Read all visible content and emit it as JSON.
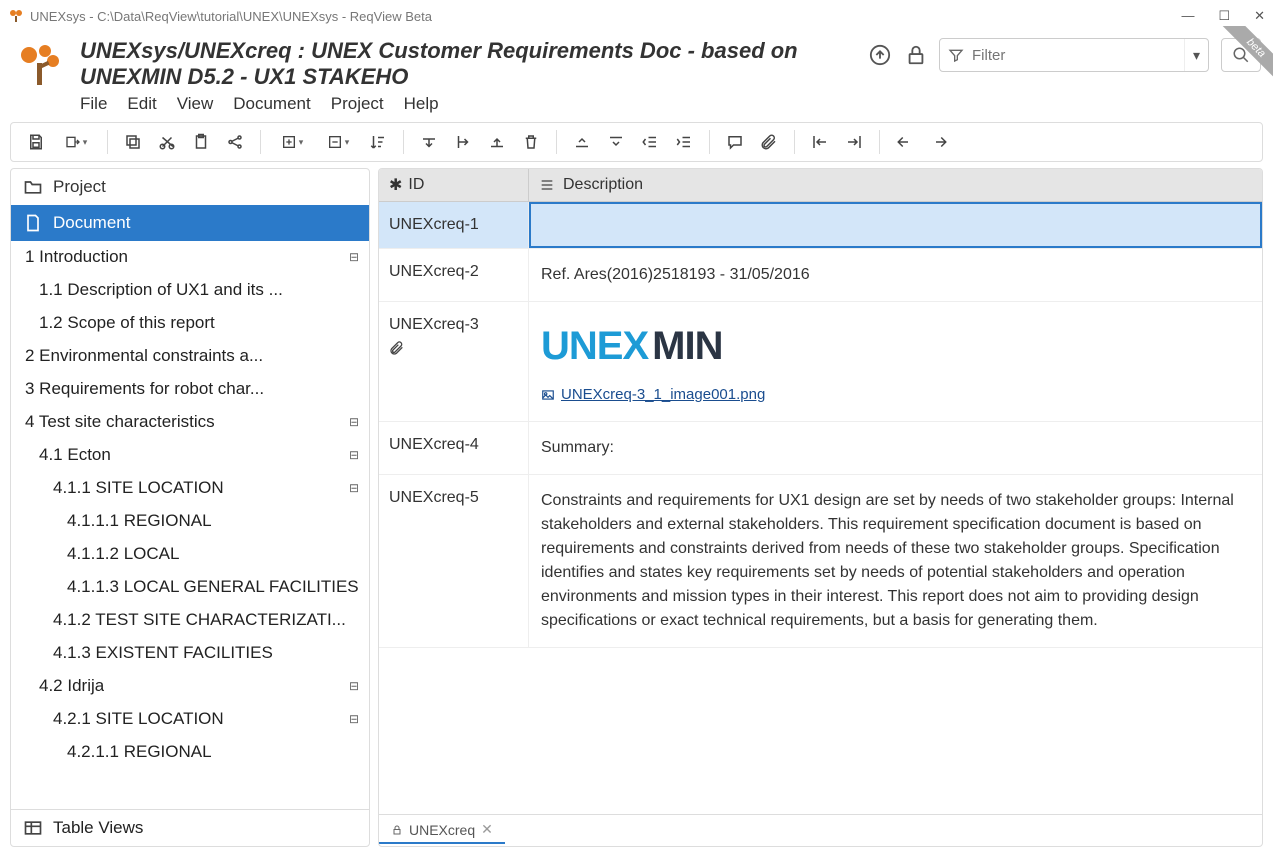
{
  "titlebar": {
    "text": "UNEXsys - C:\\Data\\ReqView\\tutorial\\UNEX\\UNEXsys - ReqView Beta"
  },
  "header": {
    "doc_title": "UNEXsys/UNEXcreq : UNEX Customer Requirements Doc - based on UNEXMIN D5.2 - UX1 STAKEHO",
    "menu": {
      "file": "File",
      "edit": "Edit",
      "view": "View",
      "document": "Document",
      "project": "Project",
      "help": "Help"
    },
    "filter_placeholder": "Filter",
    "beta_label": "beta"
  },
  "sidebar": {
    "project_label": "Project",
    "document_label": "Document",
    "table_views_label": "Table Views",
    "tree": [
      {
        "level": 1,
        "label": "1 Introduction",
        "collapsible": true
      },
      {
        "level": 2,
        "label": "1.1 Description of UX1 and its ..."
      },
      {
        "level": 2,
        "label": "1.2 Scope of this report"
      },
      {
        "level": 1,
        "label": "2 Environmental constraints a..."
      },
      {
        "level": 1,
        "label": "3 Requirements for robot char..."
      },
      {
        "level": 1,
        "label": "4 Test site characteristics",
        "collapsible": true
      },
      {
        "level": 2,
        "label": "4.1 Ecton",
        "collapsible": true
      },
      {
        "level": 3,
        "label": "4.1.1 SITE LOCATION",
        "collapsible": true
      },
      {
        "level": 4,
        "label": "4.1.1.1 REGIONAL"
      },
      {
        "level": 4,
        "label": "4.1.1.2 LOCAL"
      },
      {
        "level": 4,
        "label": "4.1.1.3 LOCAL GENERAL FACILITIES"
      },
      {
        "level": 3,
        "label": "4.1.2 TEST SITE CHARACTERIZATI..."
      },
      {
        "level": 3,
        "label": "4.1.3 EXISTENT FACILITIES"
      },
      {
        "level": 2,
        "label": "4.2 Idrija",
        "collapsible": true
      },
      {
        "level": 3,
        "label": "4.2.1 SITE LOCATION",
        "collapsible": true
      },
      {
        "level": 4,
        "label": "4.2.1.1 REGIONAL"
      }
    ]
  },
  "table": {
    "col_id": "ID",
    "col_desc": "Description",
    "rows": [
      {
        "id": "UNEXcreq-1",
        "desc": "",
        "selected": true
      },
      {
        "id": "UNEXcreq-2",
        "desc": "Ref. Ares(2016)2518193 - 31/05/2016"
      },
      {
        "id": "UNEXcreq-3",
        "desc": "",
        "has_attachment": true,
        "attachment_name": "UNEXcreq-3_1_image001.png",
        "has_logo": true
      },
      {
        "id": "UNEXcreq-4",
        "desc": "Summary:"
      },
      {
        "id": "UNEXcreq-5",
        "desc": "Constraints and requirements for UX1 design are set by needs of two stakeholder groups: Internal stakeholders and external stakeholders. This requirement specification document is based on requirements and constraints derived from needs of these two stakeholder groups. Specification identifies and states key requirements set by needs of potential stakeholders and operation environments and mission types in their interest. This report does not aim to providing design specifications or exact technical requirements, but a basis for generating them."
      }
    ]
  },
  "doc_tab": {
    "label": "UNEXcreq"
  },
  "logo_text": {
    "part1": "UNEX",
    "part2": "MIN"
  }
}
